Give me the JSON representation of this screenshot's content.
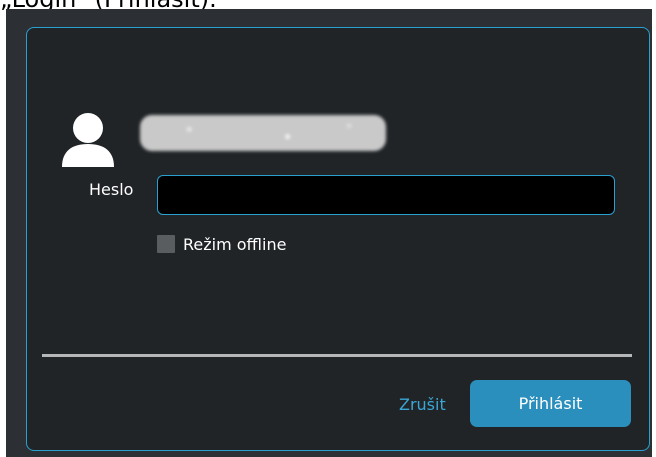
{
  "caption": "„Login“ (Přihlásit).",
  "dialog": {
    "password_label": "Heslo",
    "password_value": "",
    "offline_label": "Režim offline",
    "cancel_label": "Zrušit",
    "login_label": "Přihlásit",
    "accent_color": "#2aa0d0"
  },
  "icons": {
    "avatar": "user-icon"
  }
}
